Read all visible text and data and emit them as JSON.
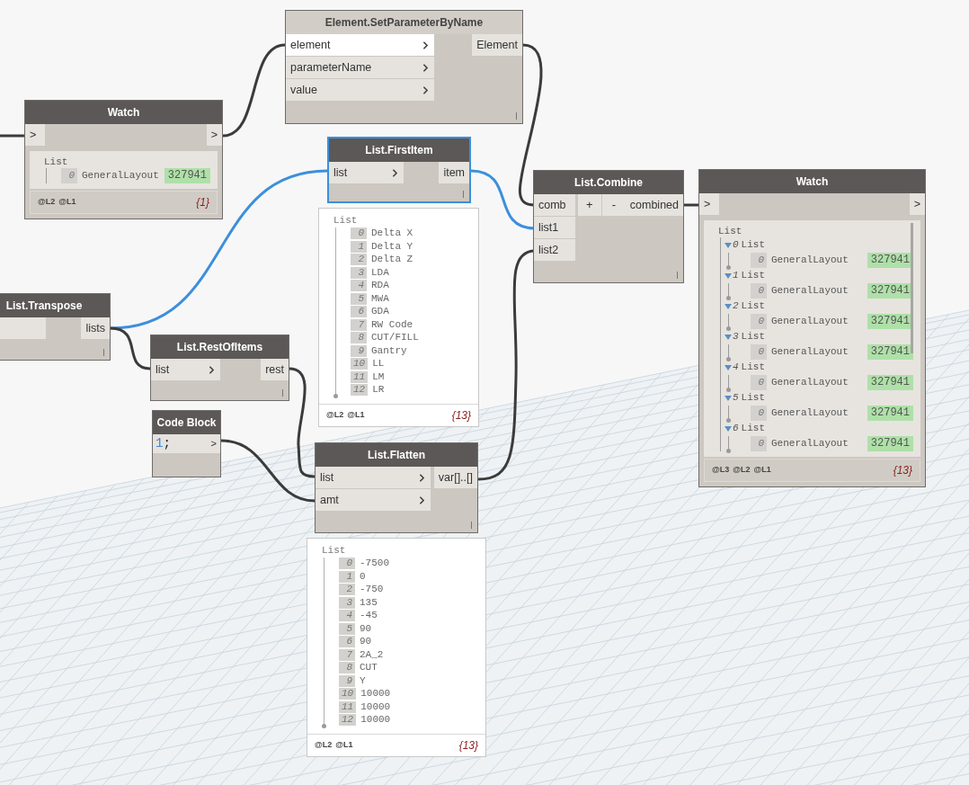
{
  "nodes": [
    {
      "kind": "function",
      "title": "Element.SetParameterByName",
      "selected": false,
      "frozen": true,
      "inputs": [
        {
          "name": "element",
          "highlighted": true
        },
        {
          "name": "parameterName",
          "highlighted": false
        },
        {
          "name": "value",
          "highlighted": false
        }
      ],
      "outputs": [
        {
          "name": "Element"
        }
      ]
    },
    {
      "kind": "watch",
      "title": "Watch",
      "selected": false,
      "frozen": false,
      "inputs": [
        {
          "name": ">"
        }
      ],
      "outputs": [
        {
          "name": ">"
        }
      ],
      "watch": {
        "root": "List",
        "items": [
          {
            "kind": "value",
            "index": "0",
            "label": "GeneralLayout",
            "value": "327941"
          }
        ],
        "levels": [
          "@L2",
          "@L1"
        ],
        "count": "{1}"
      }
    },
    {
      "kind": "function",
      "title": "List.FirstItem",
      "selected": true,
      "frozen": false,
      "inputs": [
        {
          "name": "list"
        }
      ],
      "outputs": [
        {
          "name": "item"
        }
      ],
      "preview": {
        "root": "List",
        "items": [
          {
            "index": "0",
            "value": "Delta X"
          },
          {
            "index": "1",
            "value": "Delta Y"
          },
          {
            "index": "2",
            "value": "Delta Z"
          },
          {
            "index": "3",
            "value": "LDA"
          },
          {
            "index": "4",
            "value": "RDA"
          },
          {
            "index": "5",
            "value": "MWA"
          },
          {
            "index": "6",
            "value": "GDA"
          },
          {
            "index": "7",
            "value": "RW Code"
          },
          {
            "index": "8",
            "value": "CUT/FILL"
          },
          {
            "index": "9",
            "value": "Gantry"
          },
          {
            "index": "10",
            "value": "LL"
          },
          {
            "index": "11",
            "value": "LM"
          },
          {
            "index": "12",
            "value": "LR"
          }
        ],
        "levels": [
          "@L2",
          "@L1"
        ],
        "count": "{13}"
      }
    },
    {
      "kind": "function",
      "title": "List.Combine",
      "selected": false,
      "frozen": false,
      "inputs": [
        {
          "name": "comb"
        },
        {
          "name": "list1"
        },
        {
          "name": "list2"
        }
      ],
      "buttons": [
        "+",
        "-"
      ],
      "outputs": [
        {
          "name": "combined"
        }
      ]
    },
    {
      "kind": "watch",
      "title": "Watch",
      "selected": false,
      "frozen": false,
      "inputs": [
        {
          "name": ">"
        }
      ],
      "outputs": [
        {
          "name": ">"
        }
      ],
      "watch": {
        "root": "List",
        "items": [
          {
            "kind": "list",
            "index": "0",
            "label": "List",
            "expanded": true,
            "children": [
              {
                "kind": "value",
                "index": "0",
                "label": "GeneralLayout",
                "value": "327941"
              }
            ]
          },
          {
            "kind": "list",
            "index": "1",
            "label": "List",
            "expanded": true,
            "children": [
              {
                "kind": "value",
                "index": "0",
                "label": "GeneralLayout",
                "value": "327941"
              }
            ]
          },
          {
            "kind": "list",
            "index": "2",
            "label": "List",
            "expanded": true,
            "children": [
              {
                "kind": "value",
                "index": "0",
                "label": "GeneralLayout",
                "value": "327941"
              }
            ]
          },
          {
            "kind": "list",
            "index": "3",
            "label": "List",
            "expanded": true,
            "children": [
              {
                "kind": "value",
                "index": "0",
                "label": "GeneralLayout",
                "value": "327941"
              }
            ]
          },
          {
            "kind": "list",
            "index": "4",
            "label": "List",
            "expanded": true,
            "children": [
              {
                "kind": "value",
                "index": "0",
                "label": "GeneralLayout",
                "value": "327941"
              }
            ]
          },
          {
            "kind": "list",
            "index": "5",
            "label": "List",
            "expanded": true,
            "children": [
              {
                "kind": "value",
                "index": "0",
                "label": "GeneralLayout",
                "value": "327941"
              }
            ]
          },
          {
            "kind": "list",
            "index": "6",
            "label": "List",
            "expanded": true,
            "children": [
              {
                "kind": "value",
                "index": "0",
                "label": "GeneralLayout",
                "value": "327941"
              }
            ]
          }
        ],
        "levels": [
          "@L3",
          "@L2",
          "@L1"
        ],
        "count": "{13}"
      }
    },
    {
      "kind": "function",
      "title": "List.Transpose",
      "selected": false,
      "frozen": false,
      "inputs": [
        {
          "kind": "unlabeled"
        }
      ],
      "outputs": [
        {
          "name": "lists"
        }
      ]
    },
    {
      "kind": "function",
      "title": "List.RestOfItems",
      "selected": false,
      "frozen": false,
      "inputs": [
        {
          "name": "list"
        }
      ],
      "outputs": [
        {
          "name": "rest"
        }
      ]
    },
    {
      "kind": "code_block",
      "title": "Code Block",
      "selected": false,
      "frozen": false,
      "code": [
        {
          "kind": "number",
          "text": "1"
        },
        {
          "kind": "punctuation",
          "text": ";"
        }
      ],
      "outputs": [
        {
          "name": ">"
        }
      ]
    },
    {
      "kind": "function",
      "title": "List.Flatten",
      "selected": false,
      "frozen": false,
      "inputs": [
        {
          "name": "list"
        },
        {
          "name": "amt"
        }
      ],
      "outputs": [
        {
          "name": "var[]..[]"
        }
      ],
      "preview": {
        "root": "List",
        "items": [
          {
            "index": "0",
            "value": "-7500"
          },
          {
            "index": "1",
            "value": "0"
          },
          {
            "index": "2",
            "value": "-750"
          },
          {
            "index": "3",
            "value": "135"
          },
          {
            "index": "4",
            "value": "-45"
          },
          {
            "index": "5",
            "value": "90"
          },
          {
            "index": "6",
            "value": "90"
          },
          {
            "index": "7",
            "value": "2A_2"
          },
          {
            "index": "8",
            "value": "CUT"
          },
          {
            "index": "9",
            "value": "Y"
          },
          {
            "index": "10",
            "value": "10000"
          },
          {
            "index": "11",
            "value": "10000"
          },
          {
            "index": "12",
            "value": "10000"
          }
        ],
        "levels": [
          "@L2",
          "@L1"
        ],
        "count": "{13}"
      }
    }
  ]
}
